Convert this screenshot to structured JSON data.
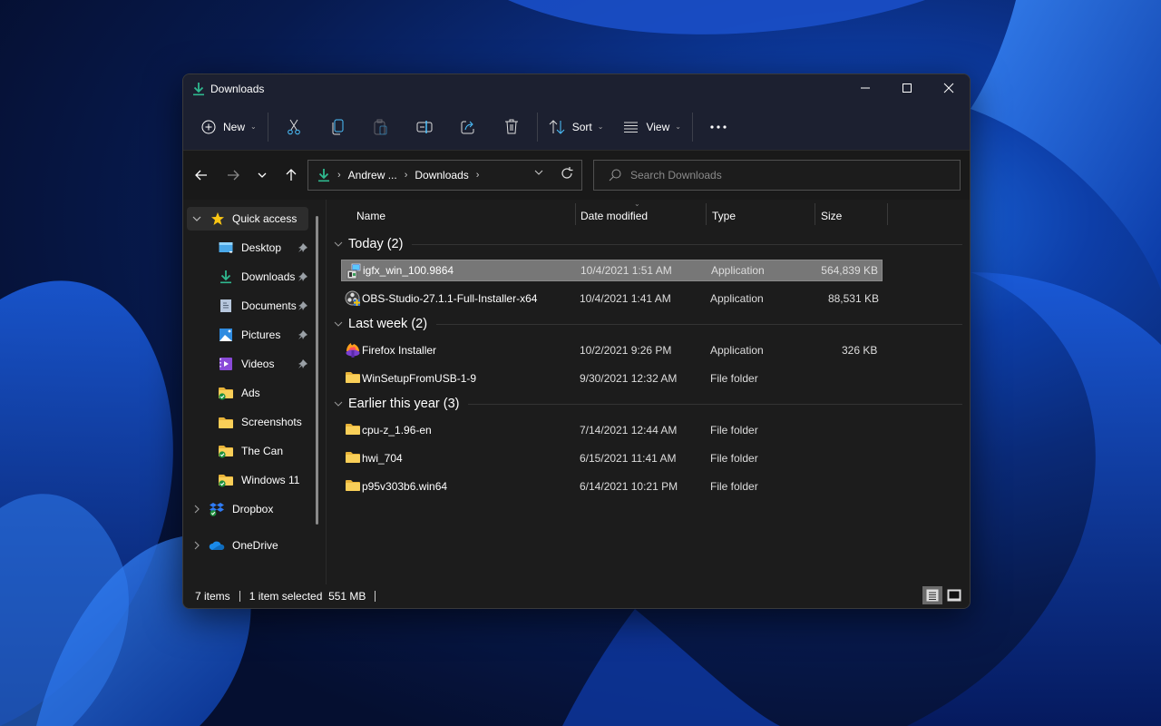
{
  "window": {
    "title": "Downloads",
    "controls": {
      "minimize": "minimize",
      "maximize": "maximize",
      "close": "close"
    }
  },
  "commandbar": {
    "new_label": "New",
    "sort_label": "Sort",
    "view_label": "View",
    "icons": [
      "plus-circle-icon",
      "cut-icon",
      "copy-icon",
      "paste-icon",
      "rename-icon",
      "share-icon",
      "delete-icon",
      "sort-icon",
      "view-icon",
      "more-icon"
    ]
  },
  "address": {
    "crumbs": [
      "Andrew ...",
      "Downloads"
    ],
    "search_placeholder": "Search Downloads"
  },
  "navpane": {
    "quick_access": "Quick access",
    "items": [
      {
        "label": "Desktop",
        "icon": "desktop-icon",
        "pinned": true
      },
      {
        "label": "Downloads",
        "icon": "download-icon",
        "pinned": true
      },
      {
        "label": "Documents",
        "icon": "documents-icon",
        "pinned": true
      },
      {
        "label": "Pictures",
        "icon": "pictures-icon",
        "pinned": true
      },
      {
        "label": "Videos",
        "icon": "videos-icon",
        "pinned": true
      },
      {
        "label": "Ads",
        "icon": "folder-synced-icon",
        "pinned": false
      },
      {
        "label": "Screenshots",
        "icon": "folder-icon",
        "pinned": false
      },
      {
        "label": "The Can",
        "icon": "folder-synced-icon",
        "pinned": false
      },
      {
        "label": "Windows 11",
        "icon": "folder-synced-icon",
        "pinned": false
      }
    ],
    "roots": [
      {
        "label": "Dropbox",
        "icon": "dropbox-icon"
      },
      {
        "label": "OneDrive",
        "icon": "onedrive-icon"
      }
    ]
  },
  "columns": {
    "name": "Name",
    "date": "Date modified",
    "type": "Type",
    "size": "Size"
  },
  "groups": [
    {
      "label": "Today (2)",
      "files": [
        {
          "name": "igfx_win_100.9864",
          "date": "10/4/2021 1:51 AM",
          "type": "Application",
          "size": "564,839 KB",
          "icon": "installer-icon",
          "selected": true
        },
        {
          "name": "OBS-Studio-27.1.1-Full-Installer-x64",
          "date": "10/4/2021 1:41 AM",
          "type": "Application",
          "size": "88,531 KB",
          "icon": "obs-icon",
          "selected": false
        }
      ]
    },
    {
      "label": "Last week (2)",
      "files": [
        {
          "name": "Firefox Installer",
          "date": "10/2/2021 9:26 PM",
          "type": "Application",
          "size": "326 KB",
          "icon": "firefox-icon",
          "selected": false
        },
        {
          "name": "WinSetupFromUSB-1-9",
          "date": "9/30/2021 12:32 AM",
          "type": "File folder",
          "size": "",
          "icon": "folder-icon",
          "selected": false
        }
      ]
    },
    {
      "label": "Earlier this year (3)",
      "files": [
        {
          "name": "cpu-z_1.96-en",
          "date": "7/14/2021 12:44 AM",
          "type": "File folder",
          "size": "",
          "icon": "folder-icon",
          "selected": false
        },
        {
          "name": "hwi_704",
          "date": "6/15/2021 11:41 AM",
          "type": "File folder",
          "size": "",
          "icon": "folder-icon",
          "selected": false
        },
        {
          "name": "p95v303b6.win64",
          "date": "6/14/2021 10:21 PM",
          "type": "File folder",
          "size": "",
          "icon": "folder-icon",
          "selected": false
        }
      ]
    }
  ],
  "status": {
    "item_count": "7 items",
    "selection": "1 item selected  551 MB"
  },
  "colors": {
    "accent_download": "#2fb98f",
    "accent_blue": "#4cc2ff",
    "selection_bg": "#777777",
    "folder_yellow": "#f5c84c"
  }
}
